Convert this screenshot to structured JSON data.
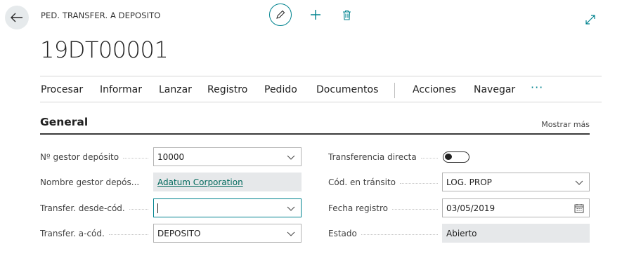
{
  "header": {
    "caption": "PED. TRANSFER. A DEPOSITO",
    "title": "19DT00001",
    "icons": [
      "back-arrow-icon",
      "pencil-icon",
      "plus-icon",
      "trash-icon",
      "expand-icon"
    ]
  },
  "actions": {
    "items": [
      "Procesar",
      "Informar",
      "Lanzar",
      "Registro",
      "Pedido",
      "Documentos",
      "Acciones",
      "Navegar"
    ],
    "more": "···"
  },
  "section": {
    "title": "General",
    "show_more": "Mostrar más"
  },
  "fields_left": [
    {
      "label": "Nº gestor depósito",
      "value": "10000"
    },
    {
      "label": "Nombre gestor depós...",
      "value": "Adatum Corporation"
    },
    {
      "label": "Transfer. desde-cód.",
      "value": ""
    },
    {
      "label": "Transfer. a-cód.",
      "value": "DEPOSITO"
    }
  ],
  "fields_right": [
    {
      "label": "Transferencia directa",
      "value": "off"
    },
    {
      "label": "Cód. en tránsito",
      "value": "LOG. PROP"
    },
    {
      "label": "Fecha registro",
      "value": "03/05/2019"
    },
    {
      "label": "Estado",
      "value": "Abierto"
    }
  ],
  "colors": {
    "accent": "#00838f",
    "link": "#00695c",
    "readonly_bg": "#e6e8ea"
  }
}
